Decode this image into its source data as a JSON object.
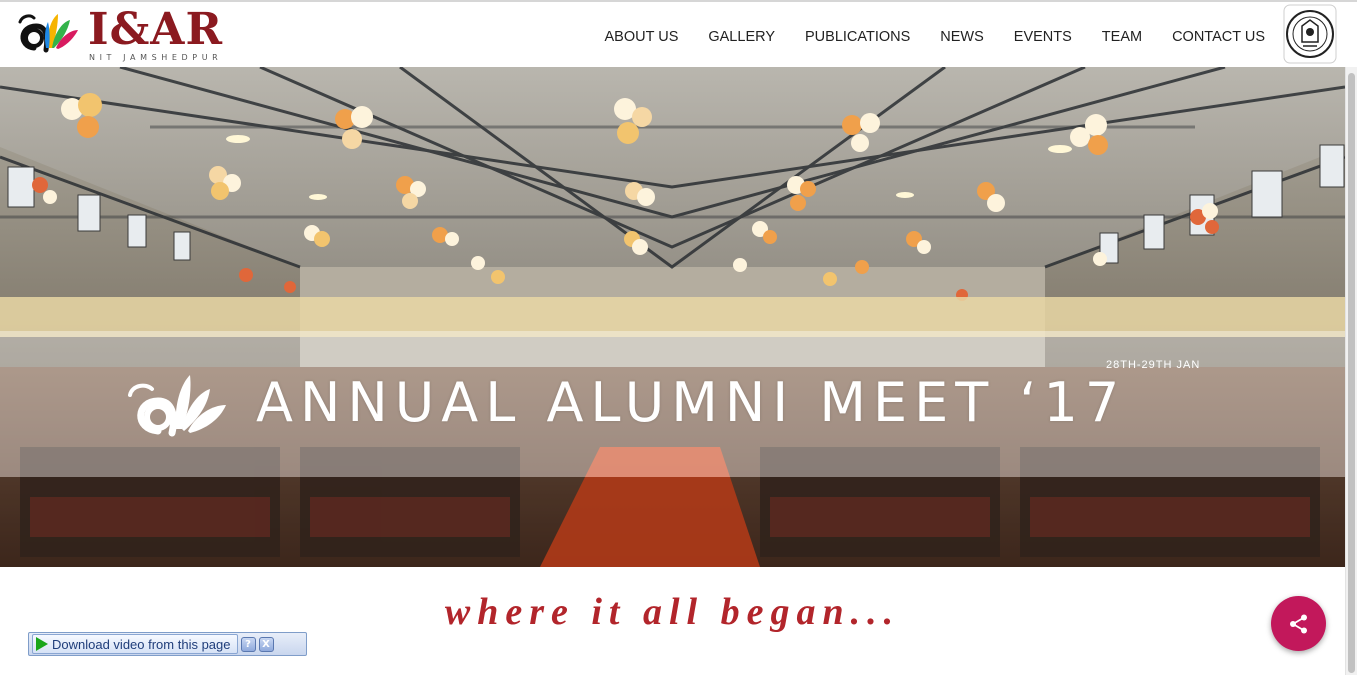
{
  "header": {
    "logo_title": "I&AR",
    "logo_subtitle": "NIT JAMSHEDPUR",
    "nav": [
      "ABOUT US",
      "GALLERY",
      "PUBLICATIONS",
      "NEWS",
      "EVENTS",
      "TEAM",
      "CONTACT US"
    ]
  },
  "hero": {
    "banner_title": "ANNUAL ALUMNI MEET ‘17",
    "banner_date": "28TH-29TH JAN"
  },
  "tagline": "where it all began...",
  "download_bar": {
    "label": "Download video from this page",
    "help": "?",
    "close": "X"
  },
  "colors": {
    "brand": "#8b1a20",
    "tagline": "#b2252b",
    "share_fab": "#c2185b"
  },
  "icons": {
    "share": "share-icon",
    "crest": "institute-crest-icon",
    "play": "play-icon"
  }
}
